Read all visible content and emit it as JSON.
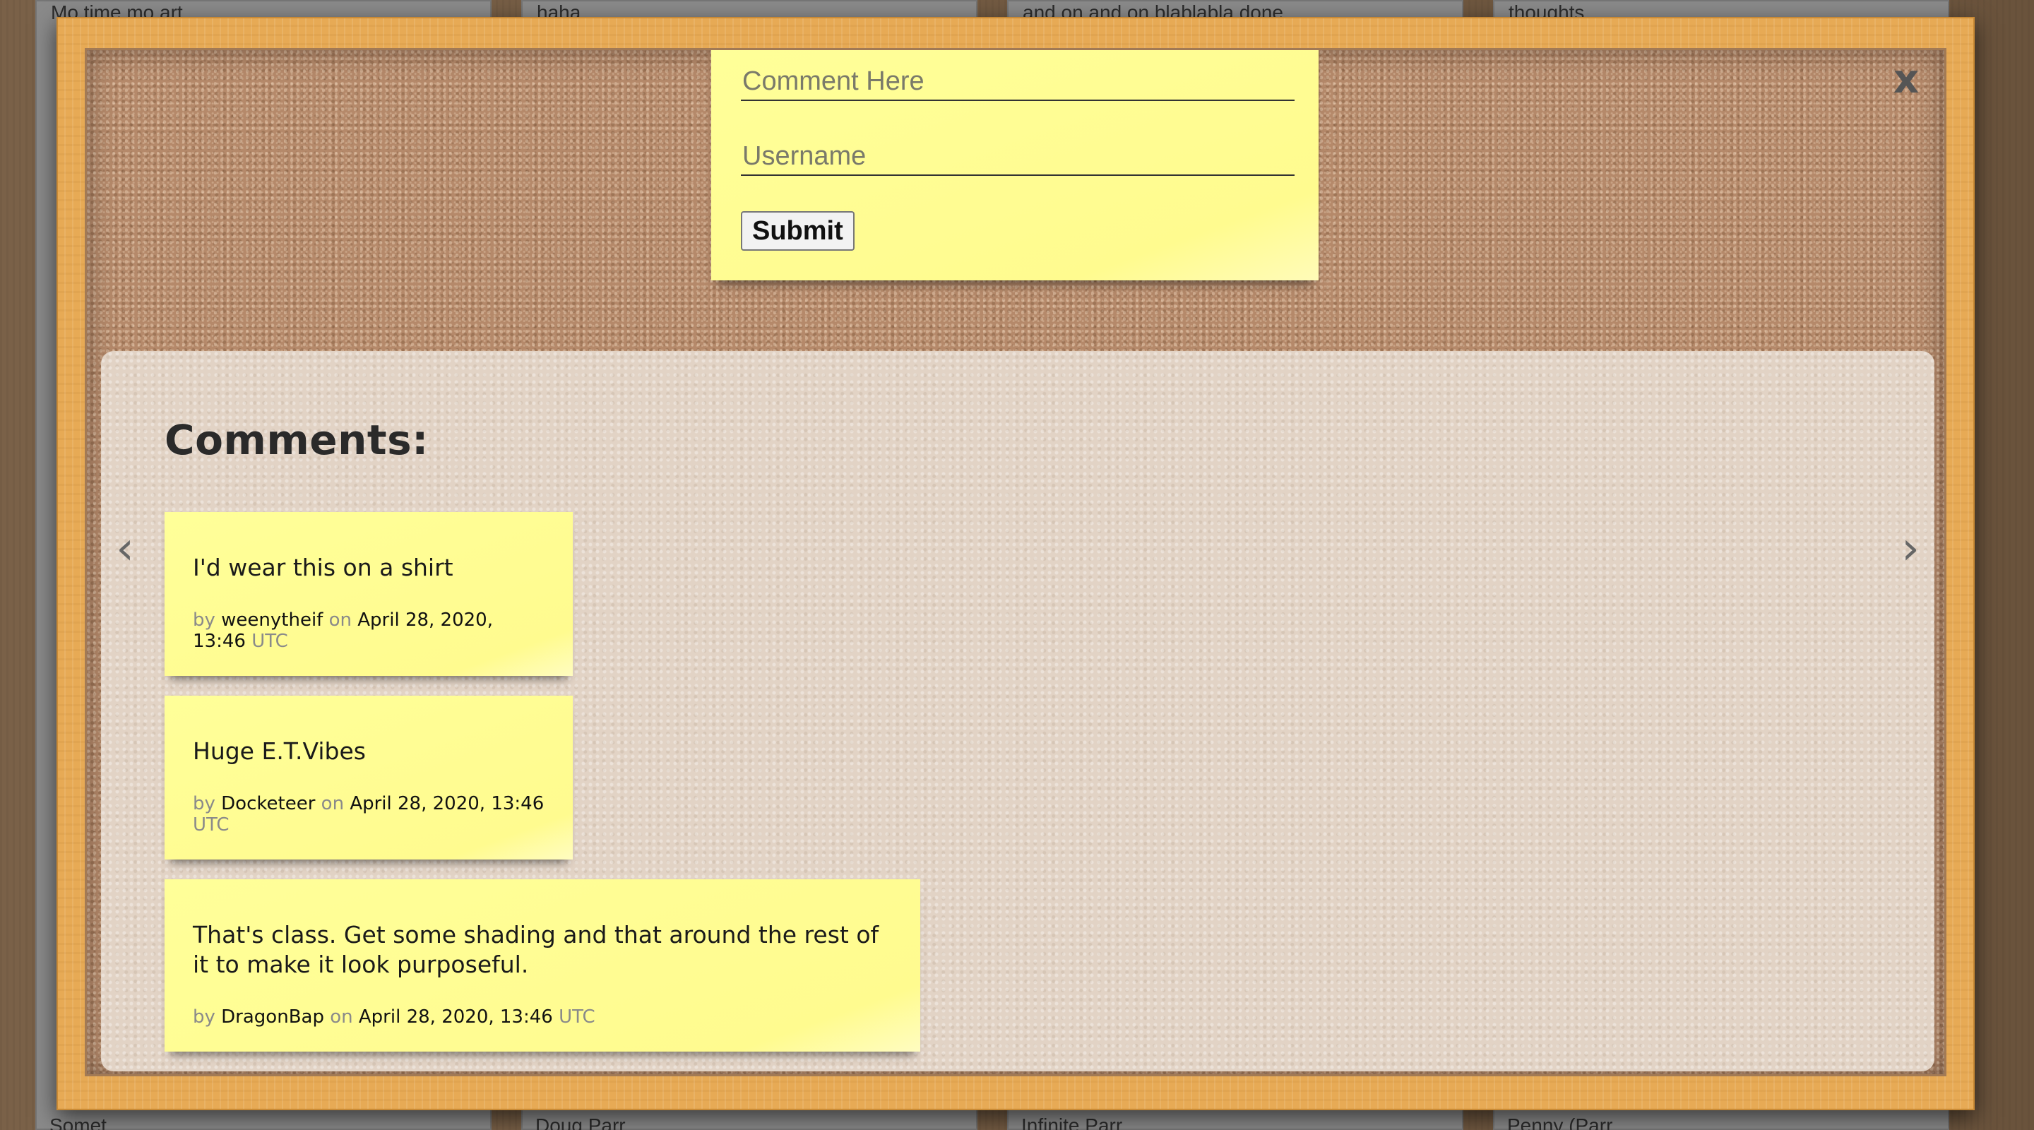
{
  "background_cards": [
    {
      "title": "Mo time mo art",
      "bottom": "Somet..."
    },
    {
      "title": "haha",
      "bottom": "Doug Parr..."
    },
    {
      "title": "and on and on blablabla done",
      "bottom": "Infinite Parr..."
    },
    {
      "title": "thoughts",
      "bottom": "Penny (Parr..."
    }
  ],
  "modal": {
    "close_label": "x",
    "form": {
      "comment_placeholder": "Comment Here",
      "username_placeholder": "Username",
      "submit_label": "Submit"
    },
    "comments_heading": "Comments:",
    "prev_label": "‹",
    "next_label": "›",
    "comments": [
      {
        "text": "I'd wear this on a shirt",
        "by_label": "by",
        "username": "weenytheif",
        "on_label": "on",
        "date": "April 28, 2020, 13:46",
        "tz": "UTC"
      },
      {
        "text": "Huge E.T.Vibes",
        "by_label": "by",
        "username": "Docketeer",
        "on_label": "on",
        "date": "April 28, 2020, 13:46",
        "tz": "UTC"
      },
      {
        "text": "That's class. Get some shading and that around the rest of it to make it look purposeful.",
        "by_label": "by",
        "username": "DragonBap",
        "on_label": "on",
        "date": "April 28, 2020, 13:46",
        "tz": "UTC"
      }
    ]
  },
  "colors": {
    "sticky_note": "#ffff99",
    "frame": "#e7aa55",
    "cork": "#b5896a",
    "panel": "#e2d3c5"
  }
}
